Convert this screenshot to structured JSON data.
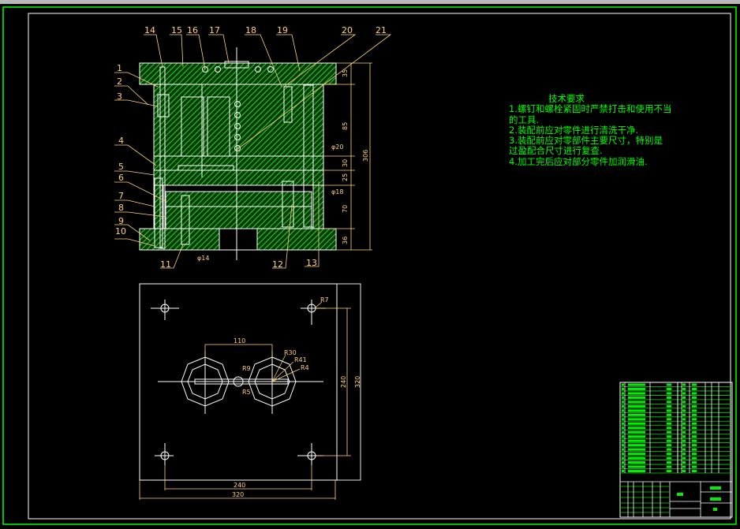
{
  "section_view": {
    "part_labels_top": [
      "14",
      "15",
      "16",
      "17",
      "18",
      "19",
      "20",
      "21"
    ],
    "part_labels_left": [
      "1",
      "2",
      "3",
      "4",
      "5",
      "6",
      "7",
      "8",
      "9",
      "10"
    ],
    "part_labels_bottom": [
      "11",
      "12",
      "13"
    ],
    "dimensions_vertical": [
      "35",
      "85",
      "30",
      "25",
      "70",
      "36"
    ],
    "dimension_total": "306",
    "diameters": [
      "φ20",
      "φ18",
      "φ14"
    ]
  },
  "plan_view": {
    "dims": {
      "spacing": "110",
      "hole_v": "240",
      "plate_v": "320",
      "hole_h": "240",
      "plate_h": "320"
    },
    "radii": [
      "R7",
      "R30",
      "R41",
      "R4",
      "R9",
      "R5"
    ]
  },
  "tech_requirements": {
    "title": "技术要求",
    "lines": [
      "1.螺钉和螺栓紧固时严禁打击和使用不当的工具.",
      "2.装配前应对零件进行清洗干净.",
      "3.装配前应对零部件主要尺寸，特别是过盈配合尺寸进行复查.",
      "4.加工完后应对部分零件加润滑油."
    ]
  },
  "colors": {
    "frame": "#00ff00",
    "lines": "#ffffff",
    "dims": "#ffd27a",
    "hatch": "#00cc00"
  }
}
